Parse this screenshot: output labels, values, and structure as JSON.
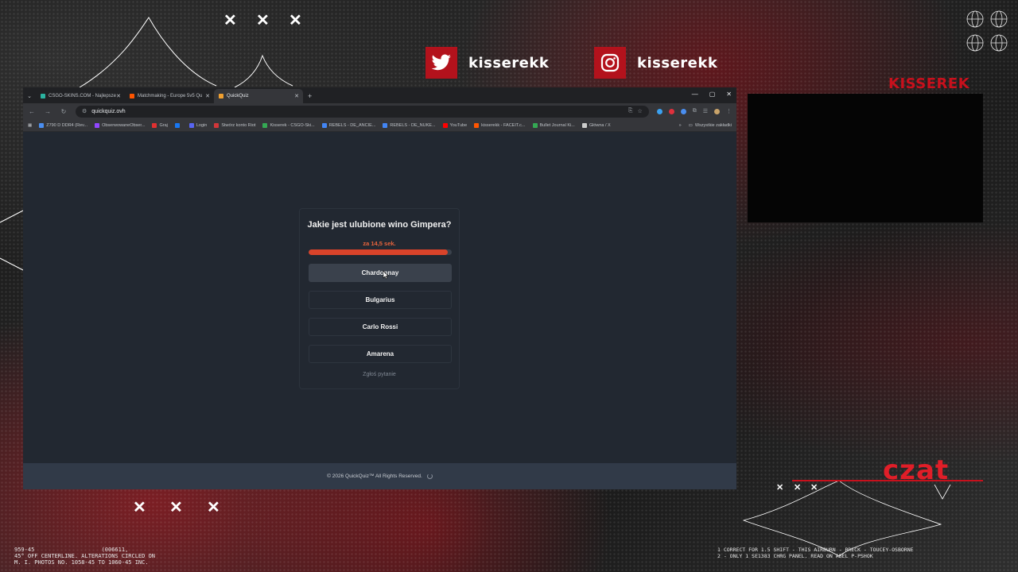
{
  "overlay": {
    "x_mark": "✕",
    "twitter": {
      "icon": "twitter-icon",
      "name": "kisserekk"
    },
    "instagram": {
      "icon": "instagram-icon",
      "name": "kisserekk"
    },
    "brand": "KISSEREK",
    "chat_label": "czat",
    "footnote_left": "959-45                    (006611,\n45° OFF CENTERLINE. ALTERATIONS CIRCLED ON\nM. I. PHOTOS NO. 1058-45 TO 1060-45 INC.",
    "footnote_right": "1 CORRECT FOR 1.5 SHIFT - THIS AIRBURN - BRECK - TOUCEY-OSBORNE\n2 - ONLY 1 SE1383 CHRG PANEL. READ ON ABEL P-PSHOK",
    "accent_color": "#c8101c"
  },
  "browser": {
    "tabs": [
      {
        "label": "CSGO-SKINS.COM - Najlepsze",
        "favicon_color": "#2bb3a0"
      },
      {
        "label": "Matchmaking - Europe 5v5 Qu",
        "favicon_color": "#ff5500"
      },
      {
        "label": "QuickQuiz",
        "favicon_color": "#f0a030"
      }
    ],
    "new_tab": "+",
    "window_controls": {
      "minimize": "—",
      "maximize": "▢",
      "close": "✕"
    },
    "url": "quickquiz.ovh",
    "bookmarks": [
      {
        "label": "Z790 D DDR4 (Rev...",
        "color": "#4a8ef0"
      },
      {
        "label": "ObserwowaneObser...",
        "color": "#9146ff"
      },
      {
        "label": "Graj",
        "color": "#e03030"
      },
      {
        "label": "",
        "color": "#1877f2"
      },
      {
        "label": "Login",
        "color": "#5865f2"
      },
      {
        "label": "Stwórz konto Riot",
        "color": "#d13639"
      },
      {
        "label": "Kisserek - CSGO-Ski...",
        "color": "#34a853"
      },
      {
        "label": "REBELS - DE_ANCIE...",
        "color": "#4285f4"
      },
      {
        "label": "REBELS - DE_NUKE...",
        "color": "#4285f4"
      },
      {
        "label": "YouTube",
        "color": "#ff0000"
      },
      {
        "label": "kisserekk - FACEIT.c...",
        "color": "#ff5500"
      },
      {
        "label": "Bullet Journal Ki...",
        "color": "#34a853"
      },
      {
        "label": "Główna / X",
        "color": "#cccccc"
      }
    ],
    "bookmarks_more": "»",
    "all_bookmarks": "Wszystkie zakładki"
  },
  "quiz": {
    "question": "Jakie jest ulubione wino Gimpera?",
    "timer_text": "za 14,5 sek.",
    "time_remaining_fraction": 0.97,
    "answers": [
      "Chardonnay",
      "Bulgarius",
      "Carlo Rossi",
      "Amarena"
    ],
    "report_label": "Zgłoś pytanie",
    "progress_color": "#d9432a",
    "timer_color": "#e8643c"
  },
  "footer": {
    "copyright": "© 2026  QuickQuiz™ All Rights Reserved."
  }
}
